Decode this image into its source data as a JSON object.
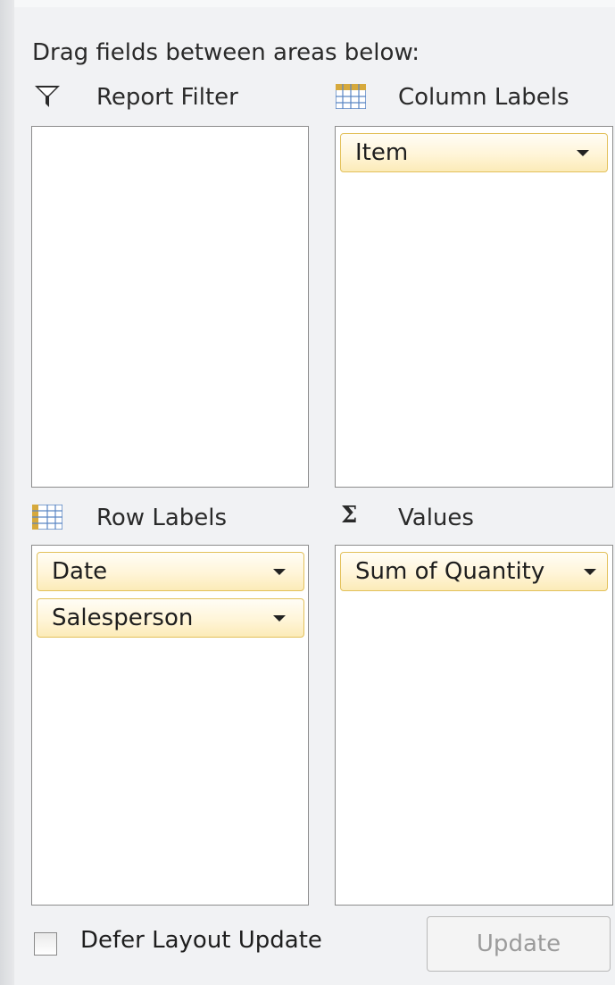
{
  "instructions": "Drag fields between areas below:",
  "areas": {
    "report_filter": {
      "label": "Report Filter",
      "icon": "filter-icon",
      "fields": []
    },
    "column_labels": {
      "label": "Column Labels",
      "icon": "grid-icon",
      "fields": [
        "Item"
      ]
    },
    "row_labels": {
      "label": "Row Labels",
      "icon": "grid-icon",
      "fields": [
        "Date",
        "Salesperson"
      ]
    },
    "values": {
      "label": "Values",
      "icon": "sigma-icon",
      "fields": [
        "Sum of Quantity"
      ]
    }
  },
  "footer": {
    "defer_label": "Defer Layout Update",
    "defer_checked": false,
    "update_label": "Update"
  },
  "colors": {
    "chip_border": "#e3c15b",
    "chip_fill": "#fff5d8",
    "grid_icon_blue": "#5a86c4",
    "grid_icon_gold": "#d6a93c"
  }
}
